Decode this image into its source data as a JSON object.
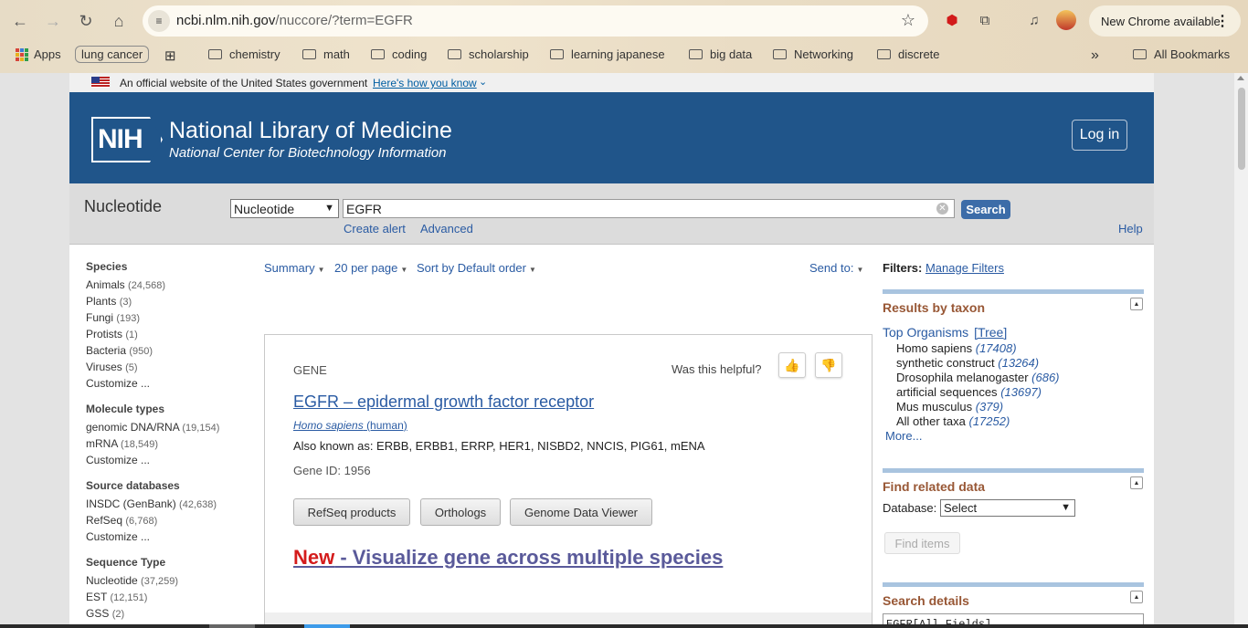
{
  "browser": {
    "url_host": "ncbi.nlm.nih.gov",
    "url_path": "/nuccore/?term=EGFR",
    "new_chrome": "New Chrome available"
  },
  "bookmarks": {
    "apps": "Apps",
    "lung": "lung cancer",
    "items": [
      "chemistry",
      "math",
      "coding",
      "scholarship",
      "learning japanese",
      "big data",
      "Networking",
      "discrete"
    ],
    "more": "»",
    "all": "All Bookmarks"
  },
  "gov_banner": {
    "text": "An official website of the United States government",
    "link": "Here's how you know"
  },
  "header": {
    "logo": "NIH",
    "title": "National Library of Medicine",
    "subtitle": "National Center for Biotechnology Information",
    "login": "Log in"
  },
  "search": {
    "db_title": "Nucleotide",
    "db_selected": "Nucleotide",
    "query": "EGFR",
    "button": "Search",
    "create_alert": "Create alert",
    "advanced": "Advanced",
    "help": "Help"
  },
  "facets": [
    {
      "head": "Species",
      "items": [
        {
          "label": "Animals",
          "count": "(24,568)"
        },
        {
          "label": "Plants",
          "count": "(3)"
        },
        {
          "label": "Fungi",
          "count": "(193)"
        },
        {
          "label": "Protists",
          "count": "(1)"
        },
        {
          "label": "Bacteria",
          "count": "(950)"
        },
        {
          "label": "Viruses",
          "count": "(5)"
        },
        {
          "label": "Customize ...",
          "count": ""
        }
      ]
    },
    {
      "head": "Molecule types",
      "items": [
        {
          "label": "genomic DNA/RNA",
          "count": "(19,154)"
        },
        {
          "label": "mRNA",
          "count": "(18,549)"
        },
        {
          "label": "Customize ...",
          "count": ""
        }
      ]
    },
    {
      "head": "Source databases",
      "items": [
        {
          "label": "INSDC (GenBank)",
          "count": "(42,638)"
        },
        {
          "label": "RefSeq",
          "count": "(6,768)"
        },
        {
          "label": "Customize ...",
          "count": ""
        }
      ]
    },
    {
      "head": "Sequence Type",
      "items": [
        {
          "label": "Nucleotide",
          "count": "(37,259)"
        },
        {
          "label": "EST",
          "count": "(12,151)"
        },
        {
          "label": "GSS",
          "count": "(2)"
        }
      ]
    }
  ],
  "display": {
    "summary": "Summary",
    "per_page": "20 per page",
    "sort": "Sort by Default order",
    "send_to": "Send to:"
  },
  "gene": {
    "label": "GENE",
    "helpful": "Was this helpful?",
    "title": "EGFR  –  epidermal growth factor receptor",
    "organism_latin": "Homo sapiens",
    "organism_common": "(human)",
    "aka": "Also known as: ERBB, ERBB1, ERRP, HER1, NISBD2, NNCIS, PIG61, mENA",
    "gene_id": "Gene ID: 1956",
    "btn_refseq": "RefSeq products",
    "btn_orthologs": "Orthologs",
    "btn_gdv": "Genome Data Viewer",
    "new_label": "New",
    "new_text": " - Visualize gene across multiple species"
  },
  "right": {
    "filters_label": "Filters:",
    "manage_filters": "Manage Filters",
    "results_by_taxon": "Results by taxon",
    "top_organisms": "Top Organisms",
    "tree": "[Tree]",
    "taxa": [
      {
        "name": "Homo sapiens",
        "count": "(17408)"
      },
      {
        "name": "synthetic construct",
        "count": "(13264)"
      },
      {
        "name": "Drosophila melanogaster",
        "count": "(686)"
      },
      {
        "name": "artificial sequences",
        "count": "(13697)"
      },
      {
        "name": "Mus musculus",
        "count": "(379)"
      },
      {
        "name": "All other taxa",
        "count": "(17252)"
      }
    ],
    "more": "More...",
    "find_related": "Find related data",
    "database_label": "Database:",
    "database_selected": "Select",
    "find_items": "Find items",
    "search_details": "Search details",
    "search_details_value": "EGFR[All Fields]"
  }
}
